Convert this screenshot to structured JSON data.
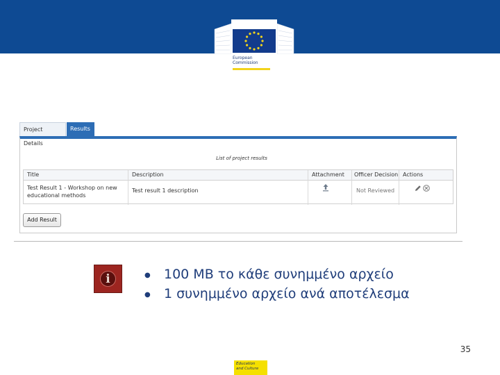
{
  "header": {
    "logo_line1": "European",
    "logo_line2": "Commission",
    "banner_color": "#0e4a93",
    "accent_color": "#f2d31b"
  },
  "screenshot": {
    "tabs": [
      {
        "label": "Project Details",
        "active": false
      },
      {
        "label": "Results",
        "active": true
      }
    ],
    "caption": "List of project results",
    "columns": [
      "Title",
      "Description",
      "Attachment",
      "Officer Decision",
      "Actions"
    ],
    "rows": [
      {
        "title_line1": "Test Result 1 - Workshop on new",
        "title_line2": "educational methods",
        "description": "Test result 1 description",
        "attachment_icon": "upload-arrow-icon",
        "officer_decision": "Not Reviewed",
        "actions": [
          "edit-pencil-icon",
          "delete-circle-x-icon"
        ]
      }
    ],
    "add_button": "Add Result"
  },
  "notes": {
    "icon": "info-icon",
    "bullets": [
      "100 MB το κάθε συνημμένο αρχείο",
      "1 συνημμένο αρχείο ανά αποτέλεσμα"
    ]
  },
  "page_number": "35",
  "footer": {
    "line1": "Education",
    "line2": "and Culture"
  }
}
